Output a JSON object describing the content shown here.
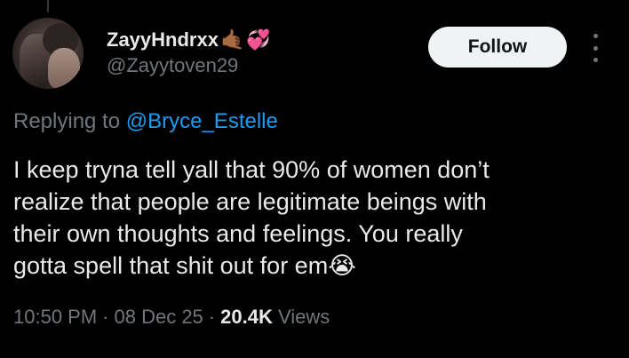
{
  "author": {
    "display_name": "ZayyHndrxx",
    "name_emojis": [
      "🤙🏾",
      "💞"
    ],
    "handle": "@Zayytoven29"
  },
  "actions": {
    "follow_label": "Follow",
    "more_icon": "more-vertical-icon"
  },
  "reply_context": {
    "prefix": "Replying to ",
    "mention": "@Bryce_Estelle"
  },
  "tweet": {
    "lines": [
      "I keep tryna tell yall that 90% of women don’t",
      "realize that people are legitimate beings with",
      "their own thoughts and feelings. You really",
      "gotta spell that shit out for em"
    ],
    "trailing_emoji": "😭"
  },
  "meta": {
    "time": "10:50 PM",
    "separator": "·",
    "date": "08 Dec 25",
    "views_count": "20.4K",
    "views_label": "Views"
  },
  "colors": {
    "background": "#000000",
    "primary_text": "#e7e9ea",
    "secondary_text": "#71767b",
    "link": "#1d9bf0",
    "follow_button_bg": "#eff3f4"
  }
}
